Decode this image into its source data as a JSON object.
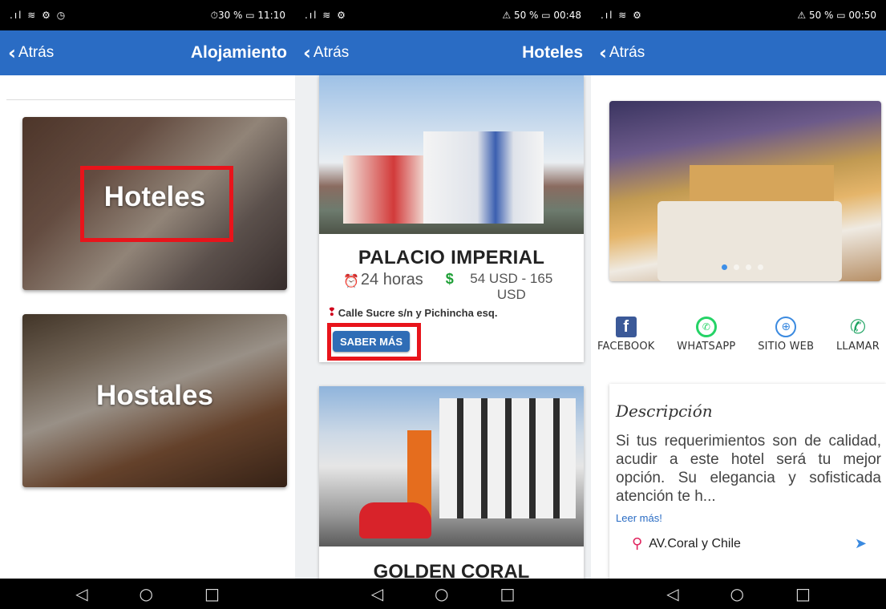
{
  "screen1": {
    "status": {
      "left": ".ıl ≋ ⚙ ◷",
      "right": "⏱30 % ▭ 11:10"
    },
    "back": "Atrás",
    "title": "Alojamiento",
    "categories": [
      {
        "label": "Hoteles"
      },
      {
        "label": "Hostales"
      }
    ]
  },
  "screen2": {
    "status": {
      "left": ".ıl ≋ ⚙",
      "right": "⚠ 50 % ▭ 00:48"
    },
    "back": "Atrás",
    "title": "Hoteles",
    "hotels": [
      {
        "name": "PALACIO IMPERIAL",
        "hours": "24 horas",
        "price": "54 USD - 165 USD",
        "address": "Calle Sucre s/n y Pichincha esq.",
        "button": "SABER MÁS"
      },
      {
        "name": "GOLDEN CORAL"
      }
    ]
  },
  "screen3": {
    "status": {
      "left": ".ıl ≋ ⚙",
      "right": "⚠ 50 % ▭ 00:50"
    },
    "back": "Atrás",
    "socials": [
      {
        "label": "FACEBOOK",
        "icon": "facebook-icon"
      },
      {
        "label": "WHATSAPP",
        "icon": "whatsapp-icon"
      },
      {
        "label": "SITIO WEB",
        "icon": "globe-icon"
      },
      {
        "label": "LLAMAR",
        "icon": "phone-icon"
      }
    ],
    "description_title": "Descripción",
    "description": "Si tus requerimientos son de calidad, acudir a este hotel será tu mejor opción. Su elegancia y sofisticada atención te h...",
    "read_more": "Leer más!",
    "location": "AV.Coral y Chile"
  },
  "colors": {
    "appbar": "#2a6cc4",
    "highlight": "#e8141b",
    "button": "#2f6db6",
    "price_icon": "#1e9f36"
  }
}
